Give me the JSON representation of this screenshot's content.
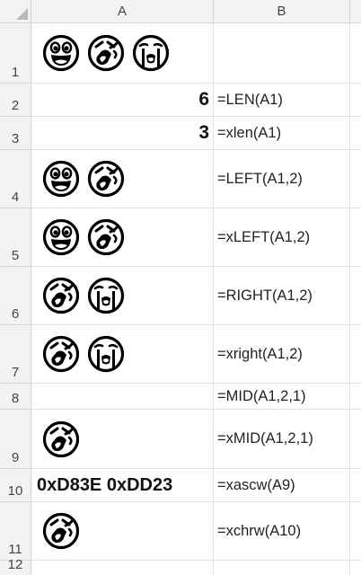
{
  "columns": [
    "A",
    "B"
  ],
  "rows": [
    {
      "num": "1",
      "a_emoji": [
        "grinning-face-icon",
        "rolling-laughing-face-icon",
        "crying-face-icon"
      ],
      "b": ""
    },
    {
      "num": "2",
      "a_text": "6",
      "b": "=LEN(A1)"
    },
    {
      "num": "3",
      "a_text": "3",
      "b": "=xlen(A1)"
    },
    {
      "num": "4",
      "a_emoji": [
        "grinning-face-icon",
        "rolling-laughing-face-icon"
      ],
      "b": "=LEFT(A1,2)"
    },
    {
      "num": "5",
      "a_emoji": [
        "grinning-face-icon",
        "rolling-laughing-face-icon"
      ],
      "b": "=xLEFT(A1,2)"
    },
    {
      "num": "6",
      "a_emoji": [
        "rolling-laughing-face-icon",
        "crying-face-icon"
      ],
      "b": "=RIGHT(A1,2)"
    },
    {
      "num": "7",
      "a_emoji": [
        "rolling-laughing-face-icon",
        "crying-face-icon"
      ],
      "b": "=xright(A1,2)"
    },
    {
      "num": "8",
      "b": "=MID(A1,2,1)"
    },
    {
      "num": "9",
      "a_emoji": [
        "rolling-laughing-face-icon"
      ],
      "b": "=xMID(A1,2,1)"
    },
    {
      "num": "10",
      "a_text": "0xD83E 0xDD23",
      "b": "=xascw(A9)"
    },
    {
      "num": "11",
      "a_emoji": [
        "rolling-laughing-face-icon"
      ],
      "b": "=xchrw(A10)"
    },
    {
      "num": "12",
      "b": ""
    }
  ]
}
